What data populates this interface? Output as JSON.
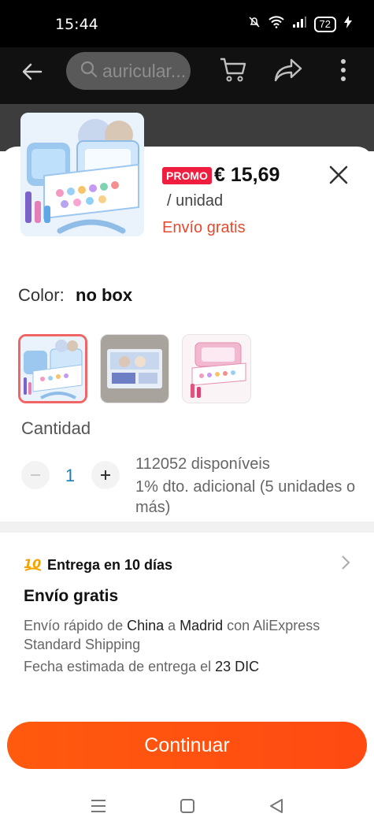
{
  "status_bar": {
    "time": "15:44",
    "battery": "72"
  },
  "app_bar": {
    "search_text": "auricular..."
  },
  "product": {
    "promo_badge": "PROMO",
    "price": "€ 15,69",
    "unit": "/ unidad",
    "shipping": "Envío gratis"
  },
  "color": {
    "label": "Color:",
    "value": "no box"
  },
  "variants": [
    "Frozen makeup case",
    "Frozen boxed set",
    "Pink makeup case"
  ],
  "quantity": {
    "label": "Cantidad",
    "value": "1",
    "stock": "112052 disponíveis",
    "discount": "1% dto. adicional (5 unidades o más)"
  },
  "delivery": {
    "badge_icon": "delivery-10-icon",
    "heading": "Entrega en 10 días",
    "free_title": "Envío gratis",
    "desc_1": "Envío rápido de ",
    "origin": "China",
    "desc_2": " a ",
    "destination": "Madrid",
    "desc_3": " con AliExpress Standard Shipping",
    "eta_prefix": "Fecha estimada de entrega el ",
    "eta_date": "23 DIC"
  },
  "cta": {
    "label": "Continuar"
  },
  "colors": {
    "accent": "#FF5A0E",
    "promo": "#EF1D3E",
    "free_shipping": "#E64A2E",
    "selected_border": "#F06565"
  }
}
